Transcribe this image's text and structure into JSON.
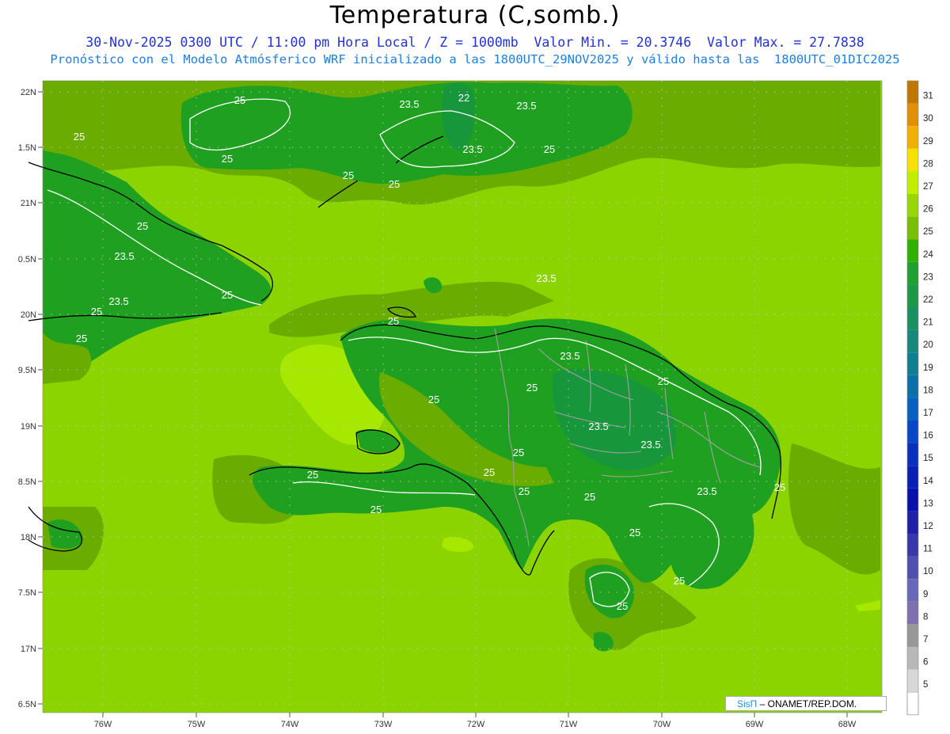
{
  "title": "Temperatura (C,somb.)",
  "subtitle_line1": "30-Nov-2025 0300 UTC / 11:00 pm Hora Local / Z = 1000mb  Valor Min. = 20.3746  Valor Max. = 27.7838",
  "subtitle_line2": "Pronóstico con el Modelo Atmósferico WRF inicializado a las 1800UTC_29NOV2025 y válido hasta las  1800UTC_01DIC2025",
  "credit": {
    "brand": "SisΠ",
    "rest": " – ONAMET/REP.DOM."
  },
  "lat_labels": [
    "22N",
    "1.5N",
    "21N",
    "0.5N",
    "20N",
    "9.5N",
    "19N",
    "8.5N",
    "18N",
    "7.5N",
    "17N",
    "6.5N"
  ],
  "lon_labels": [
    "76W",
    "75W",
    "74W",
    "73W",
    "72W",
    "71W",
    "70W",
    "69W",
    "68W"
  ],
  "contour_labels": [
    "25",
    "23.5",
    "25",
    "25",
    "23.5",
    "25",
    "25",
    "25",
    "25",
    "25",
    "23.5",
    "25",
    "23.5",
    "25",
    "23.5",
    "25",
    "25",
    "23.5",
    "25",
    "25",
    "25",
    "25",
    "25",
    "23.5",
    "25",
    "25",
    "23.5",
    "25",
    "25",
    "25",
    "25",
    "25",
    "22"
  ],
  "colorbar": {
    "labels": [
      "31",
      "30",
      "29",
      "28",
      "27",
      "26",
      "25",
      "24",
      "23",
      "22",
      "21",
      "20",
      "19",
      "18",
      "17",
      "16",
      "15",
      "14",
      "13",
      "12",
      "11",
      "10",
      "9",
      "8",
      "7",
      "6",
      "5"
    ],
    "colors": [
      "#c07800",
      "#e09000",
      "#f0b000",
      "#f8e000",
      "#c0f000",
      "#98d800",
      "#78c000",
      "#30b000",
      "#20a030",
      "#1c9848",
      "#1a9060",
      "#18887a",
      "#108090",
      "#0c70a8",
      "#0860c0",
      "#0848c8",
      "#0830c0",
      "#0820b8",
      "#0810b0",
      "#2020a8",
      "#3838a8",
      "#5050b0",
      "#6868b8",
      "#8070b0",
      "#989898",
      "#b8b8b8",
      "#d8d8d8"
    ]
  },
  "colors": {
    "sea": "#8cd400",
    "warm": "#a6e800",
    "land_mid": "#6aac00",
    "land": "#20a020",
    "land_cool": "#18963c",
    "coast": "#000000",
    "border": "#a0a0a0"
  }
}
